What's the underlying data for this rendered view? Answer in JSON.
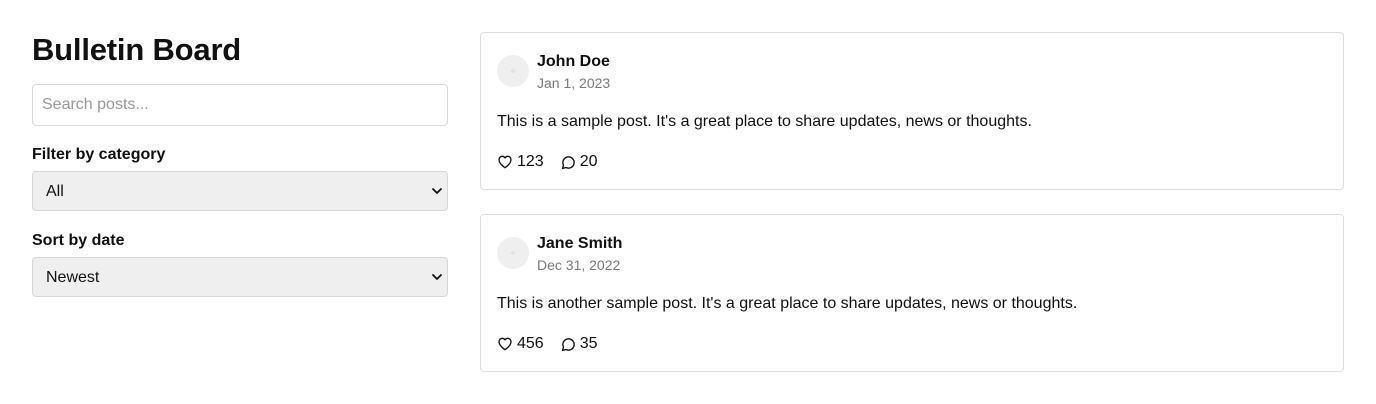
{
  "app": {
    "title": "Bulletin Board"
  },
  "search": {
    "placeholder": "Search posts...",
    "value": ""
  },
  "filters": {
    "category_label": "Filter by category",
    "category_selected": "All",
    "sort_label": "Sort by date",
    "sort_selected": "Newest"
  },
  "icons": {
    "like": "heart-icon",
    "comment": "comment-icon",
    "dropdown": "chevron-down-icon"
  },
  "colors": {
    "text": "#111111",
    "muted": "#7a7a7a",
    "border": "#dddddd",
    "select_bg": "#efefef"
  },
  "posts": [
    {
      "author": "John Doe",
      "date": "Jan 1, 2023",
      "content": "This is a sample post. It's a great place to share updates, news or thoughts.",
      "likes": "123",
      "comments": "20"
    },
    {
      "author": "Jane Smith",
      "date": "Dec 31, 2022",
      "content": "This is another sample post. It's a great place to share updates, news or thoughts.",
      "likes": "456",
      "comments": "35"
    }
  ]
}
